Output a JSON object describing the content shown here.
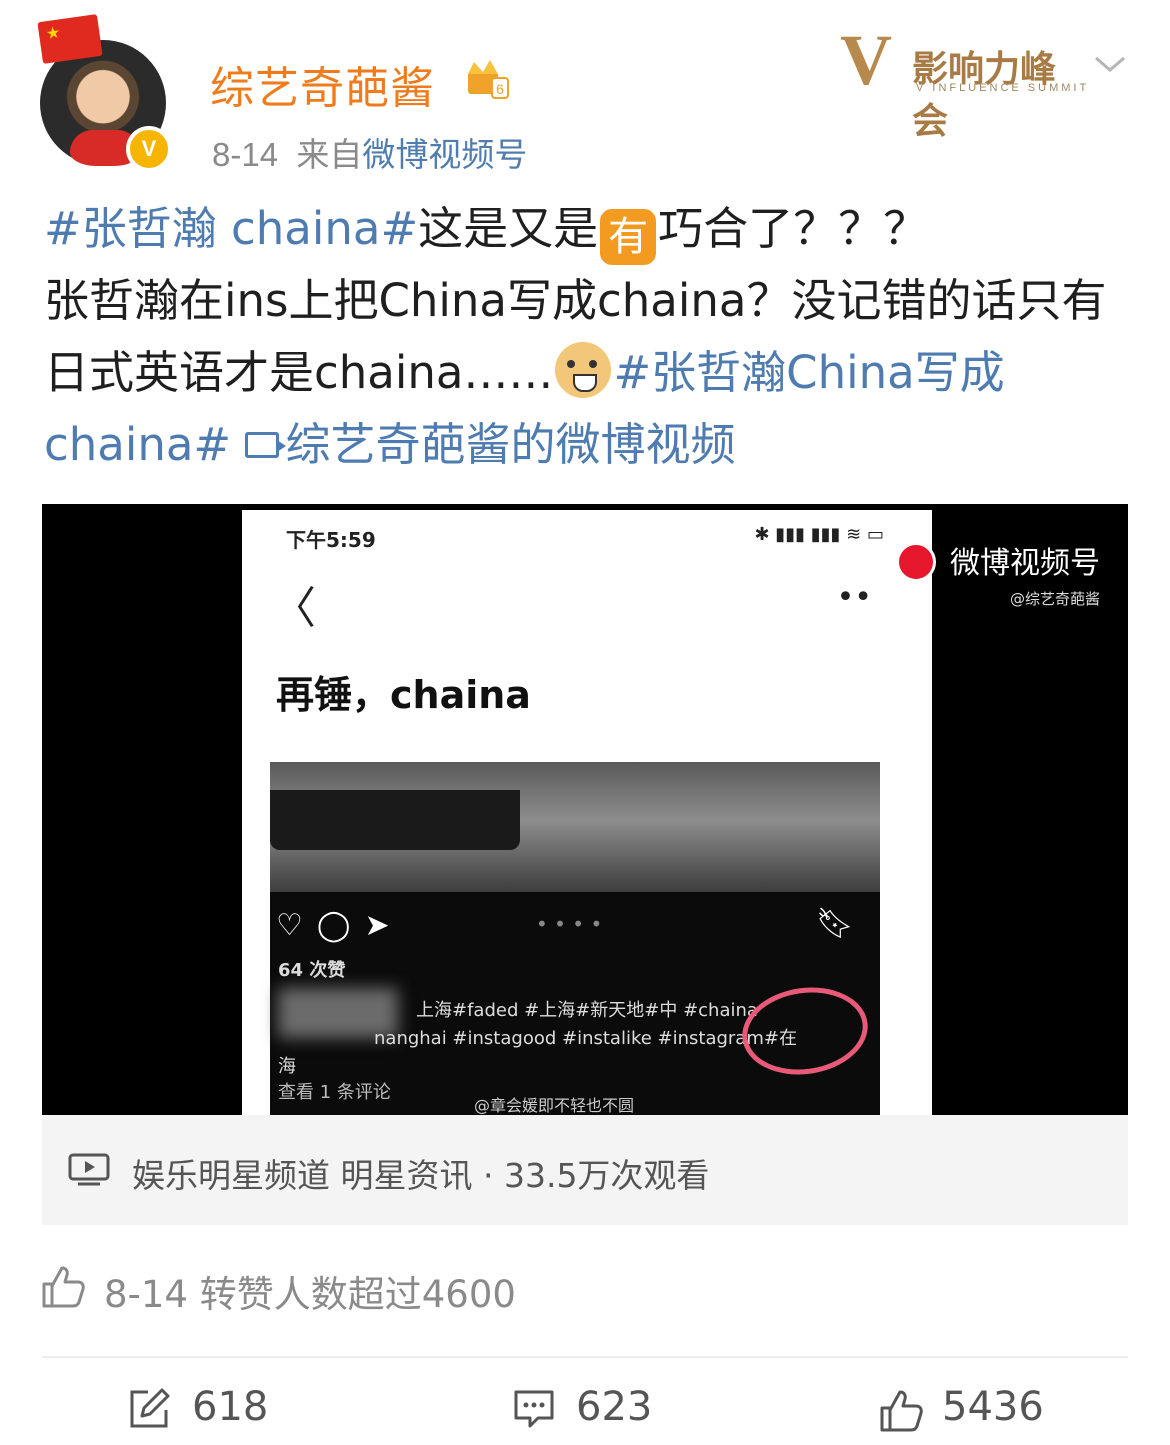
{
  "header": {
    "username": "综艺奇葩酱",
    "date": "8-14",
    "source_prefix": "来自",
    "source_name": "微博视频号",
    "summit_cn": "影响力峰会",
    "summit_en": "V INFLUENCE SUMMIT",
    "avatar_badge": "V"
  },
  "post": {
    "tag1": "#张哲瀚 chaina#",
    "t1": "这是又是",
    "emoji1": "有",
    "t2": "巧合了？？？",
    "t3": "张哲瀚在ins上把China写成chaina？没记错的话只有日式英语才是chaina……",
    "tag2": "#张哲瀚China写成chaina#",
    "video_link": "综艺奇葩酱的微博视频"
  },
  "video": {
    "status_time": "下午5:59",
    "status_right": "✱ ▮▮▮ ▮▮▮ ≋ ▭",
    "back": "〈",
    "menu": "••",
    "note_title": "再锤，chaina",
    "pager": "• • • •",
    "likes": "64 次赞",
    "caption1": "上海#faded #上海#新天地#中 #chaina",
    "caption2": "nanghai #instagood #instalike #instagram#在",
    "caption3": "海",
    "comments": "查看 1 条评论",
    "watermark_inner": "@章会媛即不轻也不圆",
    "wm_title": "微博视频号",
    "wm_handle": "@综艺奇葩酱"
  },
  "video_bar": {
    "text": "娱乐明星频道 明星资讯 · 33.5万次观看"
  },
  "like_line": {
    "text": "8-14 转赞人数超过4600"
  },
  "actions": {
    "repost_count": "618",
    "comment_count": "623",
    "like_count": "5436"
  },
  "colors": {
    "username": "#f07b1d",
    "link": "#4e7bb0",
    "meta": "#8a8a8a",
    "badge": "#f7b500"
  }
}
